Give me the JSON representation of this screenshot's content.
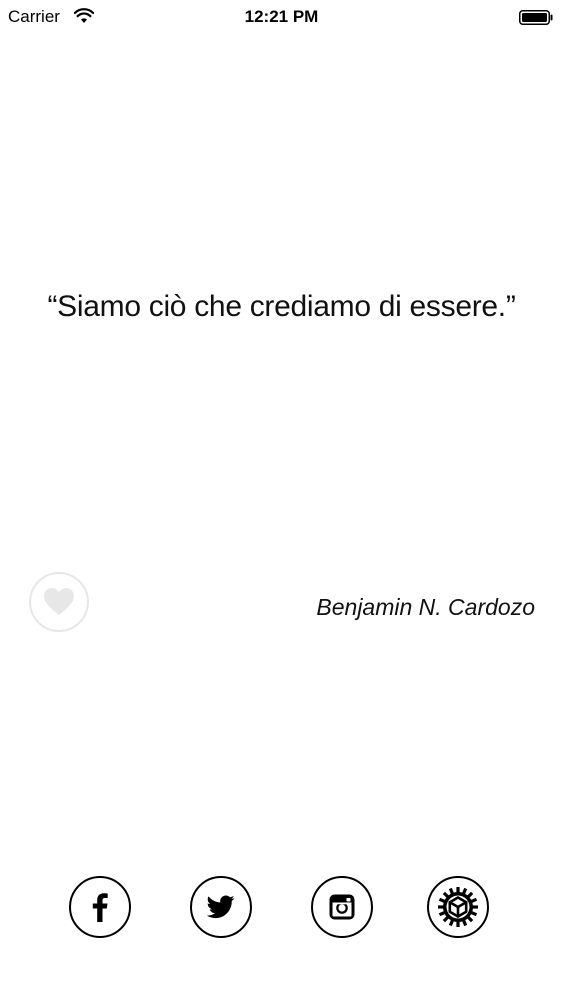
{
  "status_bar": {
    "carrier": "Carrier",
    "time": "12:21 PM"
  },
  "quote": {
    "text": "“Siamo ciò che crediamo di essere.”",
    "author": "Benjamin N. Cardozo"
  },
  "actions": {
    "favorite_icon": "heart-icon",
    "favorite_color": "#e7e7e7"
  },
  "share_bar": {
    "buttons": [
      {
        "id": "facebook",
        "icon": "facebook-icon"
      },
      {
        "id": "twitter",
        "icon": "twitter-icon"
      },
      {
        "id": "instagram",
        "icon": "instagram-icon"
      },
      {
        "id": "settings",
        "icon": "gear-icon"
      }
    ]
  }
}
